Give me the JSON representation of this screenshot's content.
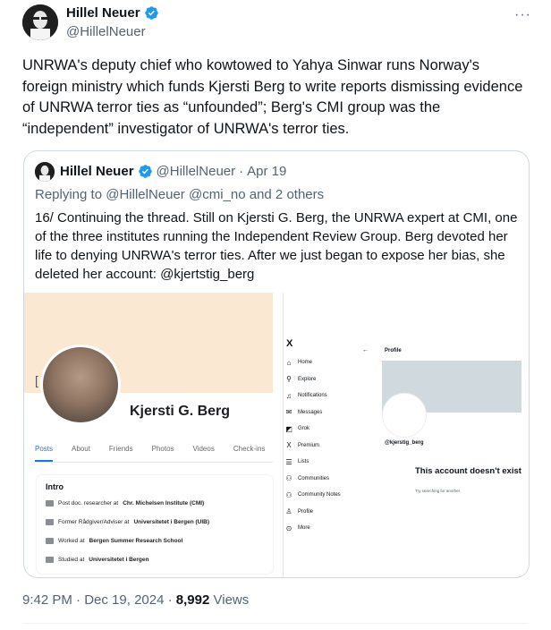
{
  "tweet": {
    "author_name": "Hillel Neuer",
    "author_handle": "@HillelNeuer",
    "text": "UNRWA's deputy chief who kowtowed to Yahya Sinwar runs Norway's foreign ministry which funds Kjersti Berg to write reports dismissing evidence of UNRWA terror ties as “unfounded”; Berg's CMI group was the “independent” investigator of UNRWA's terror ties.",
    "time": "9:42 PM",
    "date": "Dec 19, 2024",
    "views_count": "8,992",
    "views_label": "Views",
    "more_icon": "more-icon",
    "verified_color": "#1d9bf0"
  },
  "quote": {
    "author_name": "Hillel Neuer",
    "author_handle": "@HillelNeuer",
    "date": "Apr 19",
    "reply_prefix": "Replying to",
    "reply_mentions": "@HillelNeuer @cmi_no",
    "reply_suffix": "and 2 others",
    "text": "16/ Continuing the thread. Still on Kjersti G. Berg, the UNRWA expert at CMI, one of the three institutes running the Independent Review Group. Berg devoted her life to denying UNRWA's terror ties. After we just began to expose her bias, she deleted her account: @kjertstig_berg"
  },
  "facebook": {
    "bracket": "[",
    "name": "Kjersti G. Berg",
    "tabs": [
      "Posts",
      "About",
      "Friends",
      "Photos",
      "Videos",
      "Check-ins"
    ],
    "intro_title": "Intro",
    "intro_rows": [
      {
        "prefix": "Post doc. researcher at",
        "bold": "Chr. Michelsen Institute (CMI)"
      },
      {
        "prefix": "Former Rådgiver/Adviser at",
        "bold": "Universitetet i Bergen (UIB)"
      },
      {
        "prefix": "Worked at",
        "bold": "Bergen Summer Research School"
      },
      {
        "prefix": "Studied at",
        "bold": "Universitetet i Bergen"
      }
    ]
  },
  "x_profile": {
    "logo": "X",
    "nav": [
      {
        "icon": "⌂",
        "label": "Home"
      },
      {
        "icon": "⚲",
        "label": "Explore"
      },
      {
        "icon": "♫",
        "label": "Notifications"
      },
      {
        "icon": "✉",
        "label": "Messages"
      },
      {
        "icon": "◩",
        "label": "Grok"
      },
      {
        "icon": "X",
        "label": "Premium"
      },
      {
        "icon": "☰",
        "label": "Lists"
      },
      {
        "icon": "⚇",
        "label": "Communities"
      },
      {
        "icon": "⚇",
        "label": "Community Notes"
      },
      {
        "icon": "♙",
        "label": "Profile"
      },
      {
        "icon": "⊙",
        "label": "More"
      }
    ],
    "back_arrow": "←",
    "header": "Profile",
    "handle": "@kjerstig_berg",
    "not_exist": "This account doesn't exist",
    "try_text": "Try searching for another."
  }
}
